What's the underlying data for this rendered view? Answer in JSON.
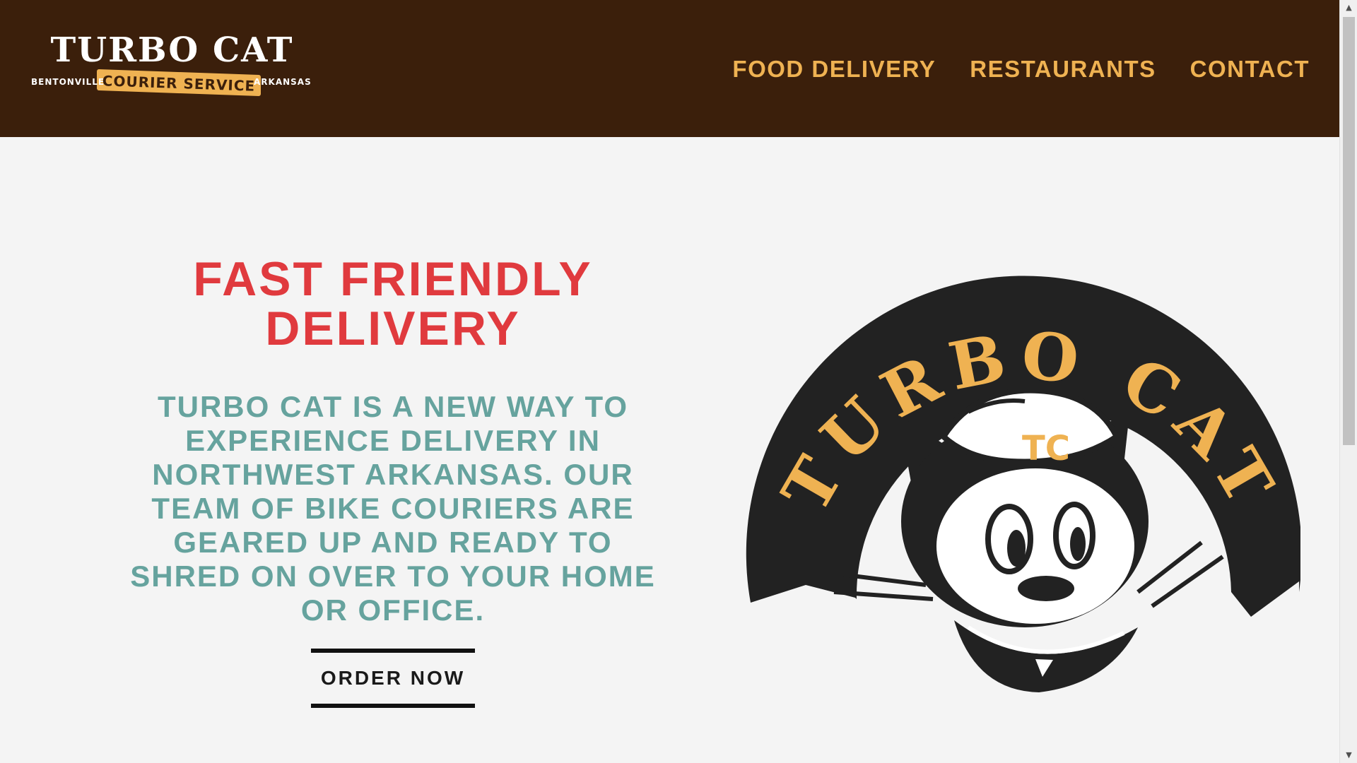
{
  "header": {
    "logo": {
      "title": "TURBO CAT",
      "banner": "COURIER SERVICE",
      "left": "BENTONVILLE",
      "right": "ARKANSAS"
    },
    "nav": [
      {
        "label": "FOOD DELIVERY"
      },
      {
        "label": "RESTAURANTS"
      },
      {
        "label": "CONTACT"
      }
    ]
  },
  "hero": {
    "title": "FAST FRIENDLY DELIVERY",
    "text": "TURBO CAT IS A NEW WAY TO EXPERIENCE DELIVERY IN NORTHWEST ARKANSAS. OUR TEAM OF BIKE COURIERS ARE GEARED UP AND READY TO SHRED ON OVER TO YOUR HOME OR OFFICE.",
    "button": "ORDER NOW",
    "badge": {
      "arc_text": "TURBO CAT",
      "cap_text": "TC"
    }
  },
  "colors": {
    "header_bg": "#3b1f0b",
    "accent": "#efb252",
    "title_red": "#e03a3e",
    "teal": "#66a39e",
    "page_bg": "#f4f4f4"
  },
  "icons": [
    "turbo-cat-badge",
    "scroll-up-icon",
    "scroll-down-icon"
  ]
}
